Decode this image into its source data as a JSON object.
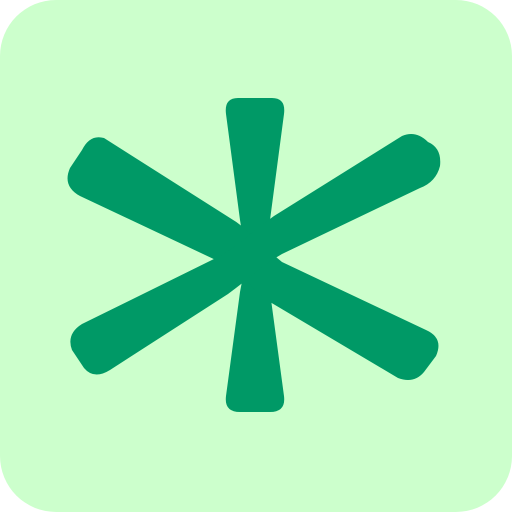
{
  "icon": {
    "name": "asterisk-icon",
    "background_color": "#CCFFCC",
    "glyph_color": "#009966"
  }
}
